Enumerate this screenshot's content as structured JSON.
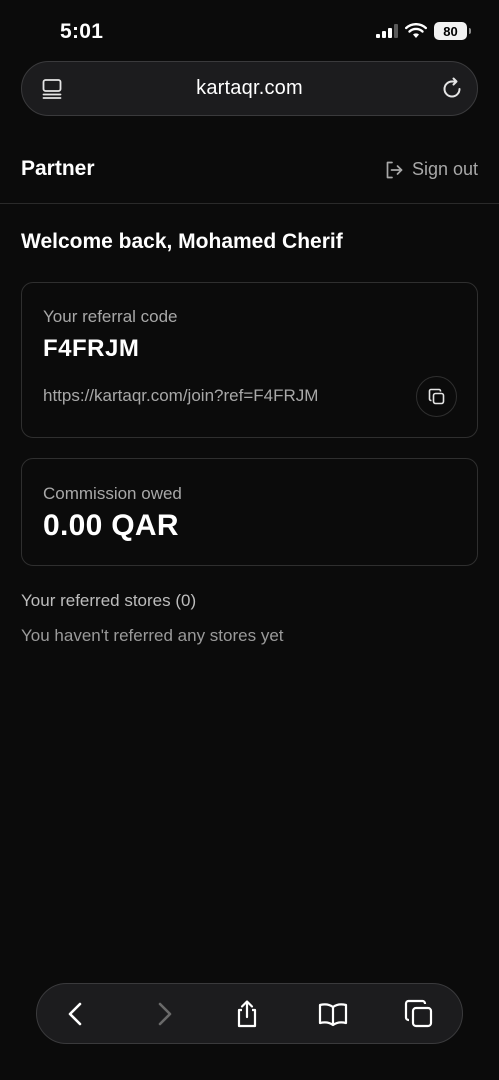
{
  "status_bar": {
    "time": "5:01",
    "battery": "80"
  },
  "browser": {
    "url": "kartaqr.com"
  },
  "header": {
    "title": "Partner",
    "sign_out": "Sign out"
  },
  "welcome": "Welcome back, Mohamed Cherif",
  "referral": {
    "label": "Your referral code",
    "code": "F4FRJM",
    "link": "https://kartaqr.com/join?ref=F4FRJM"
  },
  "commission": {
    "label": "Commission owed",
    "value": "0.00 QAR"
  },
  "stores": {
    "title": "Your referred stores (0)",
    "empty_message": "You haven't referred any stores yet"
  },
  "icons": {
    "tabs": "tabs-icon",
    "reload": "reload-icon",
    "sign_out": "sign-out-icon",
    "copy": "copy-icon",
    "back": "chevron-left-icon",
    "forward": "chevron-right-icon",
    "share": "share-icon",
    "bookmarks": "book-icon",
    "tabs_overview": "tabs-overview-icon"
  },
  "colors": {
    "background": "#0b0b0b",
    "card_border": "#2f2f2f",
    "muted_text": "#a8a8a8"
  }
}
